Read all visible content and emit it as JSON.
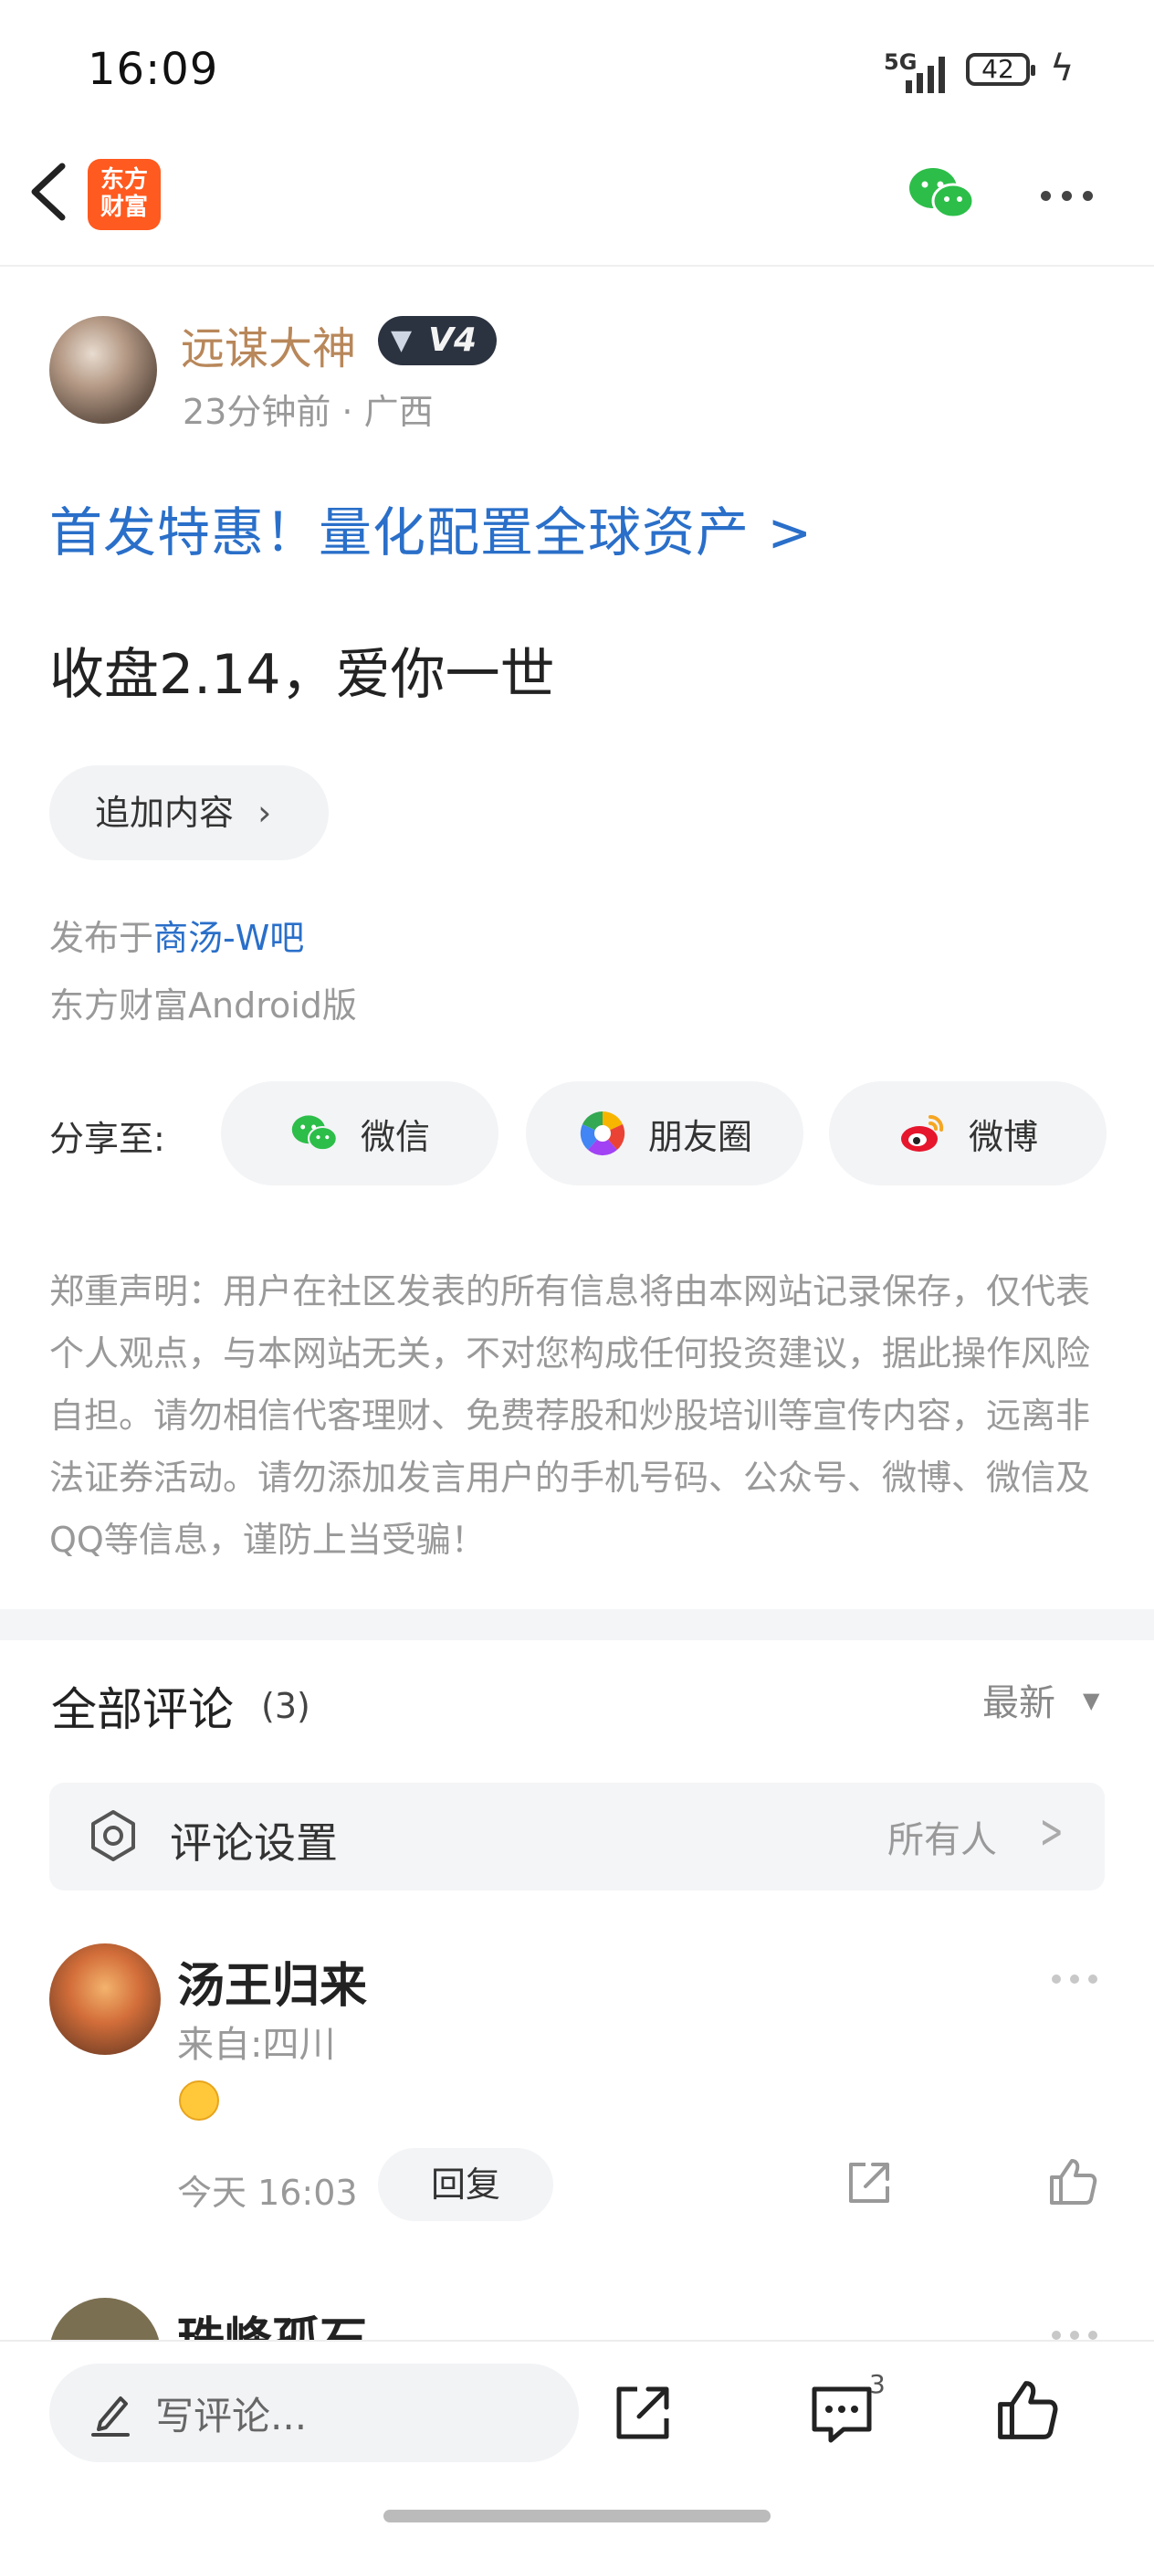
{
  "status": {
    "time": "16:09",
    "network": "5G",
    "battery": "42"
  },
  "nav": {
    "logo_line1": "东方",
    "logo_line2": "财富"
  },
  "post": {
    "author": "远谋大神",
    "level": "V4",
    "meta": "23分钟前 · 广西",
    "promo": "首发特惠！量化配置全球资产 >",
    "content": "收盘2.14，爱你一世",
    "append_label": "追加内容",
    "published_prefix": "发布于",
    "published_bar": "商汤-W吧",
    "client": "东方财富Android版"
  },
  "share": {
    "label": "分享至:",
    "wechat": "微信",
    "moments": "朋友圈",
    "weibo": "微博"
  },
  "disclaimer": "郑重声明：用户在社区发表的所有信息将由本网站记录保存，仅代表个人观点，与本网站无关，不对您构成任何投资建议，据此操作风险自担。请勿相信代客理财、免费荐股和炒股培训等宣传内容，远离非法证券活动。请勿添加发言用户的手机号码、公众号、微博、微信及QQ等信息，谨防上当受骗！",
  "comments": {
    "title": "全部评论",
    "count": "(3)",
    "sort": "最新",
    "setting_label": "评论设置",
    "setting_value": "所有人",
    "items": [
      {
        "name": "汤王归来",
        "location": "来自:四川",
        "time": "今天 16:03",
        "reply": "回复"
      },
      {
        "name": "珠峰孤石"
      }
    ]
  },
  "bottom": {
    "placeholder": "写评论...",
    "comment_badge": "3"
  },
  "colors": {
    "link": "#2a6fc9",
    "author": "#b8875a",
    "logo": "#ff5a1f",
    "wechat": "#2cbe49",
    "weibo": "#e6162d"
  }
}
